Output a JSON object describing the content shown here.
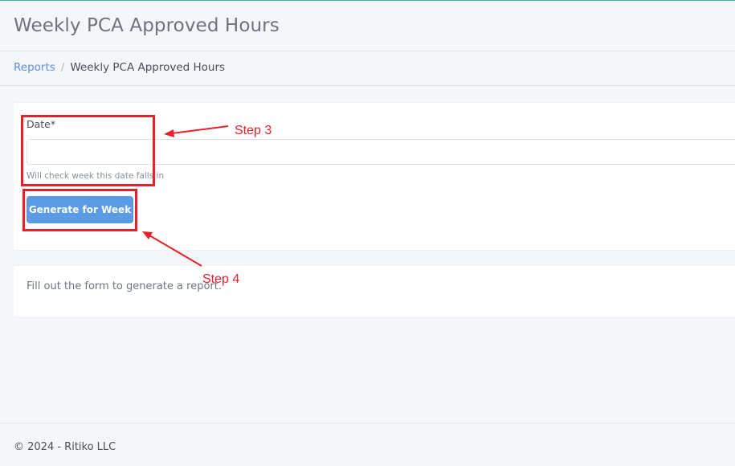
{
  "header": {
    "title": "Weekly PCA Approved Hours"
  },
  "breadcrumb": {
    "parent": "Reports",
    "separator": "/",
    "current": "Weekly PCA Approved Hours"
  },
  "form": {
    "date_label": "Date*",
    "date_value": "",
    "date_helper": "Will check week this date falls in",
    "generate_button": "Generate for Week"
  },
  "result": {
    "message": "Fill out the form to generate a report."
  },
  "footer": {
    "copyright": "© 2024 - Ritiko LLC"
  },
  "annotations": {
    "step3": "Step 3",
    "step4": "Step 4",
    "color": "#e8202a"
  },
  "colors": {
    "accent": "#5b9be6",
    "link": "#5b8fd8",
    "background": "#f4f6f9"
  }
}
